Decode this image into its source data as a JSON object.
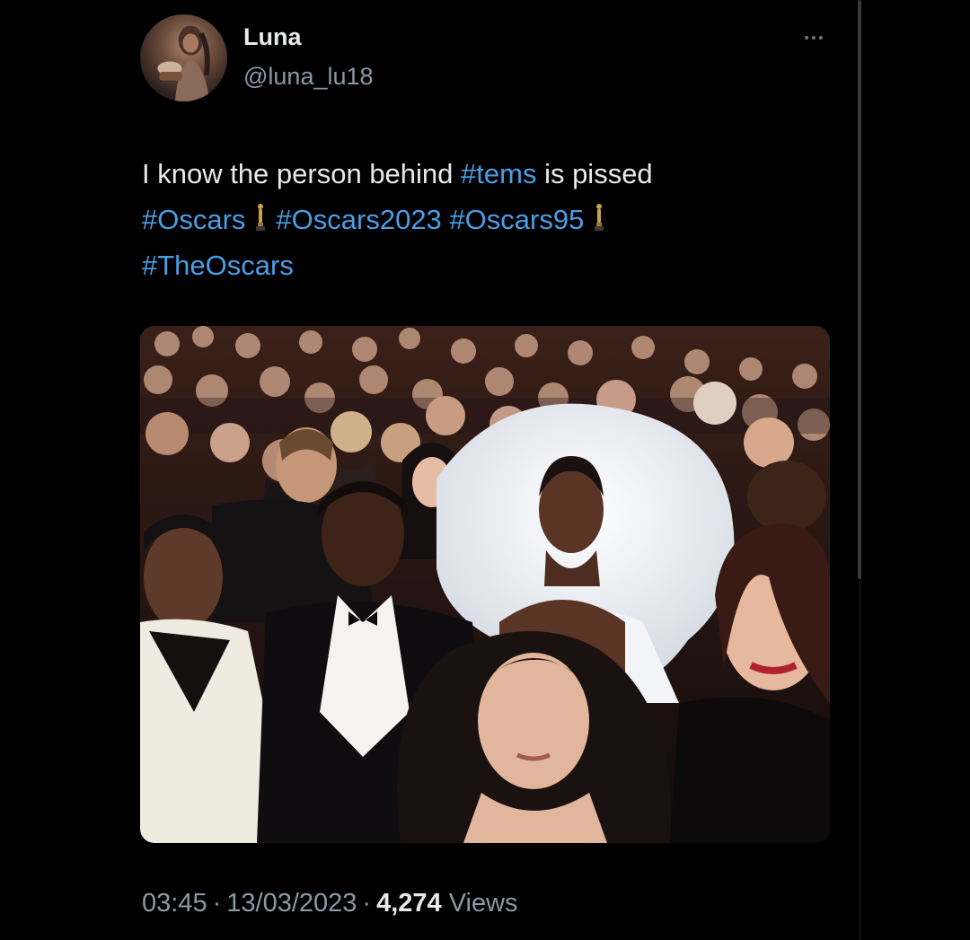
{
  "author": {
    "display_name": "Luna",
    "handle": "@luna_lu18"
  },
  "icons": {
    "more": "more-horizontal-icon",
    "oscar": "oscar-statuette-icon"
  },
  "tweet": {
    "lines": [
      [
        {
          "text": "I know the person behind ",
          "hashtag": false
        },
        {
          "text": "#tems",
          "hashtag": true
        },
        {
          "text": " is pissed",
          "hashtag": false
        }
      ],
      [
        {
          "text": "#Oscars",
          "hashtag": true
        },
        {
          "icon": "oscar"
        },
        {
          "text": "#Oscars2023",
          "hashtag": true
        },
        {
          "text": " ",
          "hashtag": false
        },
        {
          "text": "#Oscars95",
          "hashtag": true
        },
        {
          "icon": "oscar"
        }
      ],
      [
        {
          "text": "#TheOscars",
          "hashtag": true
        }
      ]
    ]
  },
  "meta": {
    "time": "03:45",
    "separator": "·",
    "date": "13/03/2023",
    "views_count": "4,274",
    "views_label": "Views"
  },
  "colors": {
    "background": "#000000",
    "text": "#e7e9ea",
    "secondary_text": "#8b98a5",
    "hashtag": "#4a9ee6"
  }
}
